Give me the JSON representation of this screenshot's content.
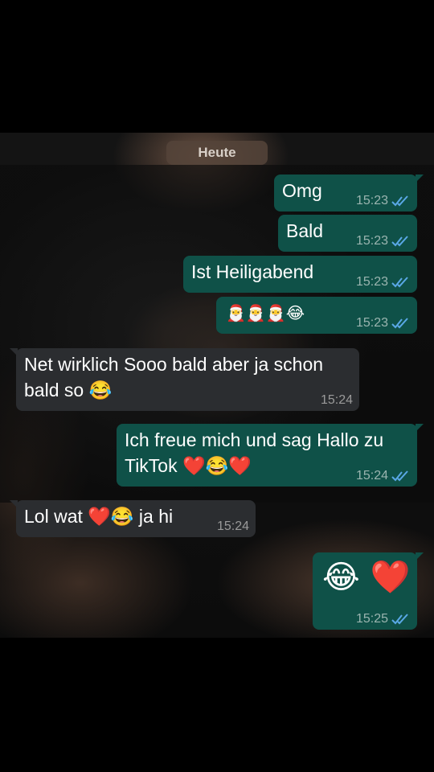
{
  "chat": {
    "date_chip": "Heute",
    "messages": [
      {
        "direction": "out",
        "text": "Omg",
        "time": "15:23",
        "status": "read"
      },
      {
        "direction": "out",
        "text": "Bald",
        "time": "15:23",
        "status": "read"
      },
      {
        "direction": "out",
        "text": "Ist Heiligabend",
        "time": "15:23",
        "status": "read"
      },
      {
        "direction": "out",
        "text": "🎅🎅🎅😂",
        "time": "15:23",
        "status": "read"
      },
      {
        "direction": "in",
        "text_line1": "Net wirklich Sooo bald aber ja schon",
        "text_line2": "bald so 😂",
        "time": "15:24"
      },
      {
        "direction": "out",
        "text_line1": "Ich freue mich und sag Hallo zu",
        "text_line2": "TikTok ❤️😂❤️",
        "time": "15:24",
        "status": "read"
      },
      {
        "direction": "in",
        "text": "Lol wat ❤️😂 ja hi",
        "time": "15:24"
      },
      {
        "direction": "out",
        "text": "😂 ❤️",
        "time": "15:25",
        "status": "read"
      }
    ]
  },
  "colors": {
    "outgoing_bubble": "#0f5148",
    "incoming_bubble": "#2b2d30",
    "read_ticks": "#5aa8e6"
  }
}
